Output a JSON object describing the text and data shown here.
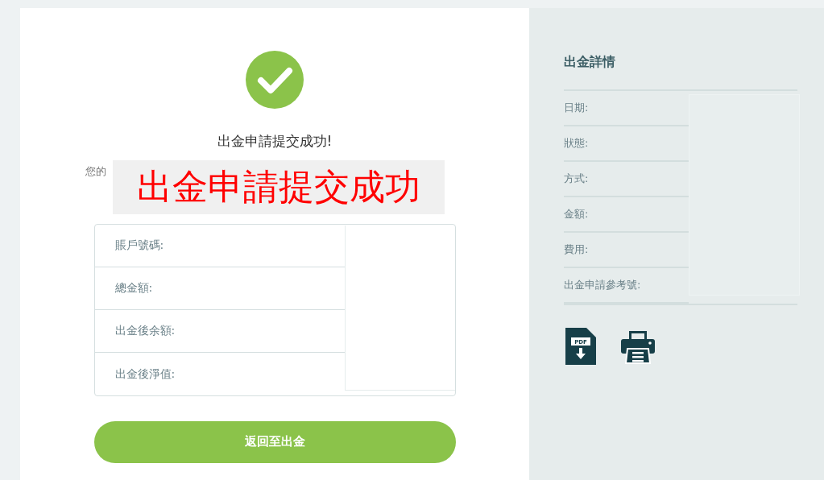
{
  "confirmation": {
    "title": "出金申請提交成功!",
    "message_visible": "您的",
    "overlay_caption": "出金申請提交成功"
  },
  "summary": {
    "rows": [
      {
        "label": "賬戶號碼:"
      },
      {
        "label": "總金額:"
      },
      {
        "label": "出金後余額:"
      },
      {
        "label": "出金後淨值:"
      }
    ]
  },
  "return_button": "返回至出金",
  "details": {
    "title": "出金詳情",
    "rows": [
      {
        "label": "日期:"
      },
      {
        "label": "狀態:"
      },
      {
        "label": "方式:"
      },
      {
        "label": "金額:"
      },
      {
        "label": "費用:"
      },
      {
        "label": "出金申請參考號:"
      }
    ],
    "actions": [
      {
        "kind": "pdf",
        "label": "PDF"
      },
      {
        "kind": "print"
      }
    ]
  }
}
